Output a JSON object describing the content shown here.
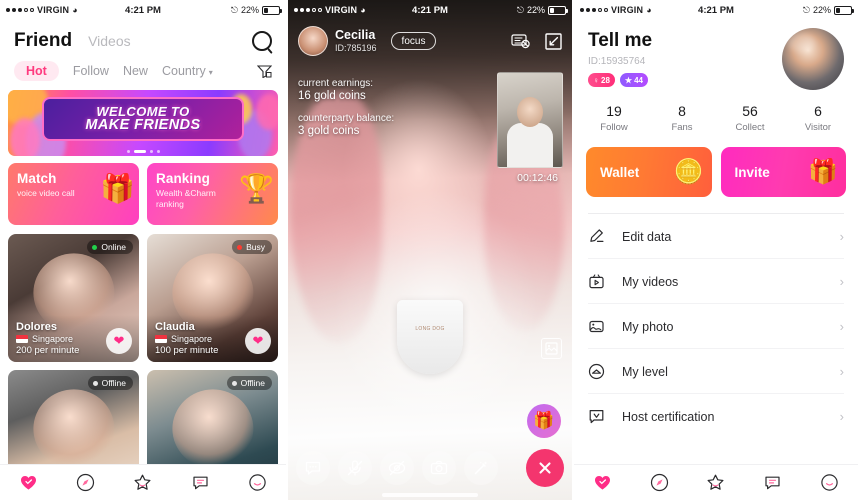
{
  "status_bar": {
    "carrier": "VIRGIN",
    "time": "4:21 PM",
    "battery": "22%",
    "wifi_icon": "wifi-icon",
    "bluetooth_icon": "bluetooth-icon"
  },
  "panel1": {
    "header": {
      "title": "Friend",
      "secondary_tab": "Videos",
      "search_icon": "search-icon"
    },
    "tabs": [
      {
        "label": "Hot",
        "active": true
      },
      {
        "label": "Follow",
        "active": false
      },
      {
        "label": "New",
        "active": false
      },
      {
        "label": "Country",
        "active": false,
        "caret": true
      }
    ],
    "filter_icon": "filter-icon",
    "banner": {
      "line1": "WELCOME TO",
      "line2": "MAKE FRIENDS"
    },
    "promos": [
      {
        "title": "Match",
        "subtitle": "voice video call",
        "art": "🎁"
      },
      {
        "title": "Ranking",
        "subtitle": "Wealth &Charm ranking",
        "art": "🏆"
      }
    ],
    "users": [
      {
        "name": "Dolores",
        "country": "Singapore",
        "rate": "200 per minute",
        "status": "Online",
        "status_type": "online"
      },
      {
        "name": "Claudia",
        "country": "Singapore",
        "rate": "100 per minute",
        "status": "Busy",
        "status_type": "busy"
      },
      {
        "name": "",
        "country": "",
        "rate": "",
        "status": "Offline",
        "status_type": "offline"
      },
      {
        "name": "",
        "country": "",
        "rate": "",
        "status": "Offline",
        "status_type": "offline"
      }
    ],
    "like_icon": "heart-icon",
    "tabbar": [
      {
        "name": "heart-icon",
        "active": true
      },
      {
        "name": "compass-icon",
        "active": false
      },
      {
        "name": "star-icon",
        "active": false
      },
      {
        "name": "message-icon",
        "active": false
      },
      {
        "name": "profile-icon",
        "active": false
      }
    ]
  },
  "panel2": {
    "caller": {
      "name": "Cecilia",
      "id": "ID:785196",
      "focus_label": "focus",
      "avatar": "caller-avatar"
    },
    "header_icons": [
      {
        "name": "report-block-icon"
      },
      {
        "name": "minimize-icon"
      }
    ],
    "earnings_label": "current earnings:",
    "earnings_value": "16 gold coins",
    "balance_label": "counterparty balance:",
    "balance_value": "3 gold coins",
    "timer": "00:12:46",
    "pip": "self-view-thumbnail",
    "photo_icon": "photo-capture-icon",
    "gift_icon": "gift-icon",
    "controls": [
      {
        "name": "chat-icon"
      },
      {
        "name": "mic-muted-icon"
      },
      {
        "name": "camera-off-icon"
      },
      {
        "name": "camera-flip-icon"
      },
      {
        "name": "beauty-wand-icon"
      }
    ],
    "end_call_icon": "end-call-icon"
  },
  "panel3": {
    "name": "Tell me",
    "id": "ID:15935764",
    "badges": [
      {
        "icon": "gender-icon",
        "value": "28",
        "color": "#ff2e79"
      },
      {
        "icon": "star-level-icon",
        "value": "44",
        "color": "#b44bff"
      }
    ],
    "avatar": "profile-avatar",
    "stats": [
      {
        "value": "19",
        "label": "Follow"
      },
      {
        "value": "8",
        "label": "Fans"
      },
      {
        "value": "56",
        "label": "Collect"
      },
      {
        "value": "6",
        "label": "Visitor"
      }
    ],
    "actions": [
      {
        "label": "Wallet",
        "art": "🪙",
        "color": "#ff7a33"
      },
      {
        "label": "Invite",
        "art": "🎁",
        "color": "#ff2e9e"
      }
    ],
    "menu": [
      {
        "label": "Edit data",
        "icon": "pencil-icon"
      },
      {
        "label": "My videos",
        "icon": "video-icon"
      },
      {
        "label": "My photo",
        "icon": "photo-icon"
      },
      {
        "label": "My level",
        "icon": "level-icon"
      },
      {
        "label": "Host certification",
        "icon": "certification-icon"
      }
    ],
    "chevron": "›",
    "tabbar": [
      {
        "name": "heart-icon",
        "active": true
      },
      {
        "name": "compass-icon",
        "active": false
      },
      {
        "name": "star-icon",
        "active": false
      },
      {
        "name": "message-icon",
        "active": false
      },
      {
        "name": "profile-icon",
        "active": false
      }
    ]
  }
}
